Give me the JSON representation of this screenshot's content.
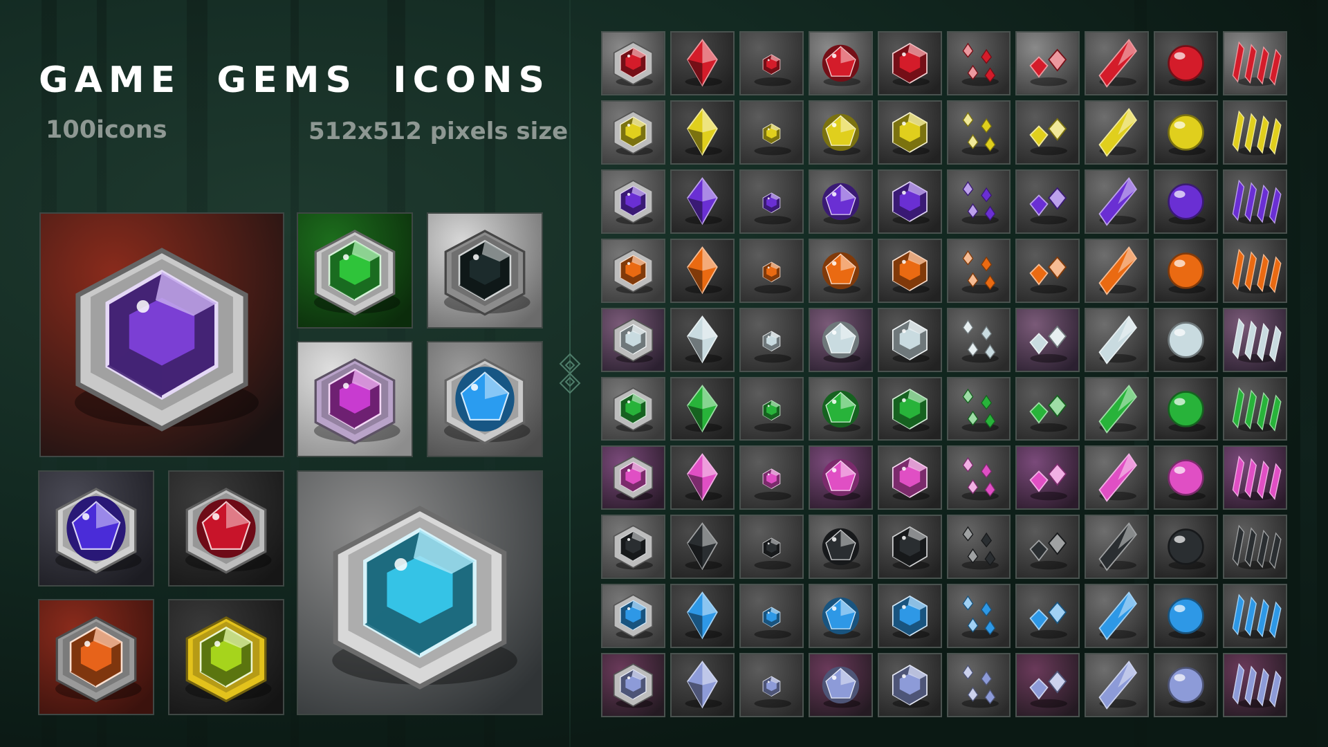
{
  "header": {
    "title_words": [
      "GAME",
      "GEMS",
      "ICONS"
    ],
    "icon_count_label": "100icons",
    "size_label": "512x512 pixels size"
  },
  "showcase": [
    {
      "name": "violet-gem-in-stone",
      "shape": "hex",
      "color": "#7b3fd4",
      "bg": [
        "#8a2b1c",
        "#1a1212"
      ],
      "setting": "#c9c9c9"
    },
    {
      "name": "green-gem-in-stone",
      "shape": "hex",
      "color": "#2fc43a",
      "bg": [
        "#1d6e1d",
        "#0b2c0b"
      ],
      "setting": "#c9c9c9"
    },
    {
      "name": "black-gem-in-stone",
      "shape": "hex",
      "color": "#1c2b2c",
      "bg": [
        "#d9d9d9",
        "#6b6b6b"
      ],
      "setting": "#8c8c8c"
    },
    {
      "name": "pink-gem-in-stone",
      "shape": "hex",
      "color": "#c83bd0",
      "bg": [
        "#e0e0e0",
        "#8d8d8d"
      ],
      "setting": "#b9a3c9"
    },
    {
      "name": "blue-gem-in-stone",
      "shape": "oval",
      "color": "#2a9cf0",
      "bg": [
        "#9a9a9a",
        "#4c4c4c"
      ],
      "setting": "#c9c9c9"
    },
    {
      "name": "indigo-gem-in-stone",
      "shape": "oval",
      "color": "#4a2cd8",
      "bg": [
        "#4a4a55",
        "#1c1c22"
      ],
      "setting": "#cfcfcf"
    },
    {
      "name": "red-gem-in-stone",
      "shape": "round",
      "color": "#c8142a",
      "bg": [
        "#3c3c3c",
        "#161616"
      ],
      "setting": "#bdbdbd"
    },
    {
      "name": "cyan-gem-in-rock",
      "shape": "hex",
      "color": "#35c3e6",
      "bg": [
        "#8f8f8f",
        "#303436"
      ],
      "setting": "#d8d8d8"
    },
    {
      "name": "orange-gem-in-stone",
      "shape": "hex",
      "color": "#e7631a",
      "bg": [
        "#8a2b1c",
        "#3b120d"
      ],
      "setting": "#9a9a9a"
    },
    {
      "name": "yellow-green-gem-in-stone",
      "shape": "hex",
      "color": "#a6d41c",
      "bg": [
        "#3a3a3a",
        "#141414"
      ],
      "setting": "#e3c21c"
    }
  ],
  "grid": {
    "rows": [
      {
        "name": "red",
        "color": "#d41c2a"
      },
      {
        "name": "yellow",
        "color": "#e0cf1d"
      },
      {
        "name": "violet",
        "color": "#6a2fd3"
      },
      {
        "name": "orange",
        "color": "#ea6a12"
      },
      {
        "name": "white-diamond",
        "color": "#c9dbe0"
      },
      {
        "name": "green",
        "color": "#28b33a"
      },
      {
        "name": "pink",
        "color": "#e04fc4"
      },
      {
        "name": "black",
        "color": "#2a2e31"
      },
      {
        "name": "blue",
        "color": "#2e98e6"
      },
      {
        "name": "opal",
        "color": "#8d9bd8"
      }
    ],
    "columns": [
      {
        "shape": "set",
        "bg": [
          "#777777",
          "#3a3a3a"
        ]
      },
      {
        "shape": "diamond",
        "bg": [
          "#4a4a4a",
          "#202020"
        ]
      },
      {
        "shape": "small",
        "bg": [
          "#5c5c5c",
          "#2a2a2a"
        ]
      },
      {
        "shape": "round",
        "bg": [
          "#6a6a6a",
          "#2c2c2c"
        ]
      },
      {
        "shape": "hex",
        "bg": [
          "#555555",
          "#222222"
        ]
      },
      {
        "shape": "cluster",
        "bg": [
          "#666666",
          "#2a2a2a"
        ]
      },
      {
        "shape": "pair",
        "bg": [
          "#5a5a5a",
          "#262626"
        ]
      },
      {
        "shape": "shard",
        "bg": [
          "#6e6e6e",
          "#2e2e2e"
        ]
      },
      {
        "shape": "orb",
        "bg": [
          "#555555",
          "#1e1e1e"
        ]
      },
      {
        "shape": "spikes",
        "bg": [
          "#5e5e5e",
          "#262626"
        ]
      }
    ],
    "row_backgrounds": {
      "0": [
        "#8a8a8a",
        "#3b3b3b"
      ],
      "4": [
        "#7a5a78",
        "#2b2030"
      ],
      "6": [
        "#7a4a7a",
        "#2b1b2b"
      ],
      "9": [
        "#6a3a5a",
        "#241a22"
      ]
    }
  }
}
